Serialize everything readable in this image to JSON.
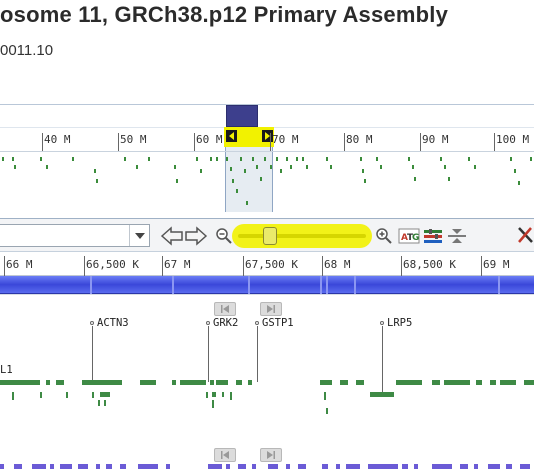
{
  "header": {
    "title": "osome 11, GRCh38.p12 Primary Assembly",
    "subtitle": "0011.10"
  },
  "overview": {
    "ticks": [
      "40 M",
      "50 M",
      "60 M",
      "70 M",
      "80 M",
      "90 M",
      "100 M"
    ]
  },
  "toolbar": {
    "search_value": ""
  },
  "ruler": {
    "ticks": [
      "66 M",
      "66,500 K",
      "67 M",
      "67,500 K",
      "68 M",
      "68,500 K",
      "69 M"
    ]
  },
  "genes": {
    "labels": [
      "ACTN3",
      "GRK2",
      "GSTP1",
      "LRP5",
      "L1"
    ]
  },
  "colors": {
    "highlight": "#f2f200",
    "sequence_bar": "#3a47d9",
    "gene_feature": "#3e8a45",
    "bottom_feature": "#6b5bd6"
  },
  "icons": [
    "back-arrow-icon",
    "forward-arrow-icon",
    "zoom-out-icon",
    "zoom-in-icon",
    "atg-icon",
    "track-config-icon",
    "collapse-icon",
    "tools-icon",
    "chevron-down-icon"
  ]
}
